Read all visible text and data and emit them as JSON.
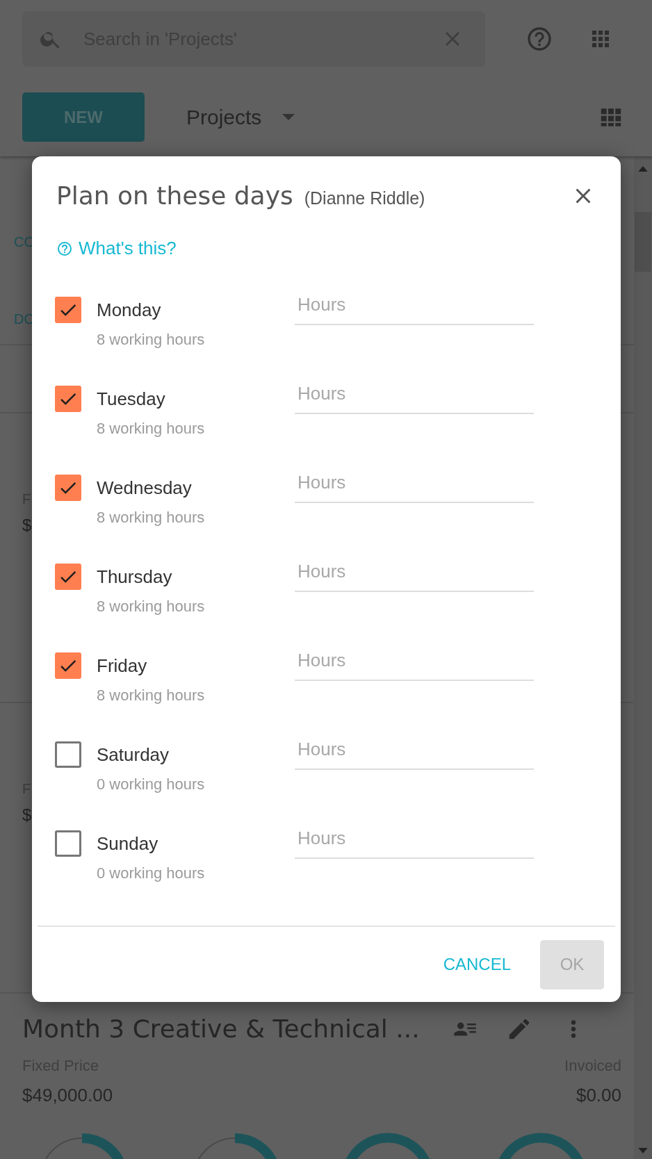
{
  "header": {
    "search": {
      "placeholder": "Search in 'Projects'"
    },
    "new_button": "NEW",
    "view": "Projects"
  },
  "background_cards": [
    {
      "lines": [
        {
          "kind": "tab",
          "text": "CO"
        },
        {
          "kind": "tab",
          "text": "DO"
        }
      ]
    },
    {
      "lines": [
        {
          "kind": "label",
          "text": "F"
        },
        {
          "kind": "amount",
          "text": "$"
        }
      ]
    },
    {
      "lines": [
        {
          "kind": "label",
          "text": "F"
        },
        {
          "kind": "amount",
          "text": "$"
        }
      ]
    }
  ],
  "project_card": {
    "title": "Month 3 Creative & Technical ...",
    "price_label": "Fixed Price",
    "price": "$49,000.00",
    "invoiced_label": "Invoiced",
    "invoiced": "$0.00"
  },
  "dialog": {
    "title": "Plan on these days",
    "subtitle": "(Dianne Riddle)",
    "help_link": "What's this?",
    "days": [
      {
        "name": "Monday",
        "note": "8 working hours",
        "checked": true,
        "placeholder": "Hours"
      },
      {
        "name": "Tuesday",
        "note": "8 working hours",
        "checked": true,
        "placeholder": "Hours"
      },
      {
        "name": "Wednesday",
        "note": "8 working hours",
        "checked": true,
        "placeholder": "Hours"
      },
      {
        "name": "Thursday",
        "note": "8 working hours",
        "checked": true,
        "placeholder": "Hours"
      },
      {
        "name": "Friday",
        "note": "8 working hours",
        "checked": true,
        "placeholder": "Hours"
      },
      {
        "name": "Saturday",
        "note": "0 working hours",
        "checked": false,
        "placeholder": "Hours"
      },
      {
        "name": "Sunday",
        "note": "0 working hours",
        "checked": false,
        "placeholder": "Hours"
      }
    ],
    "cancel": "CANCEL",
    "ok": {
      "label": "OK",
      "disabled": true
    }
  }
}
